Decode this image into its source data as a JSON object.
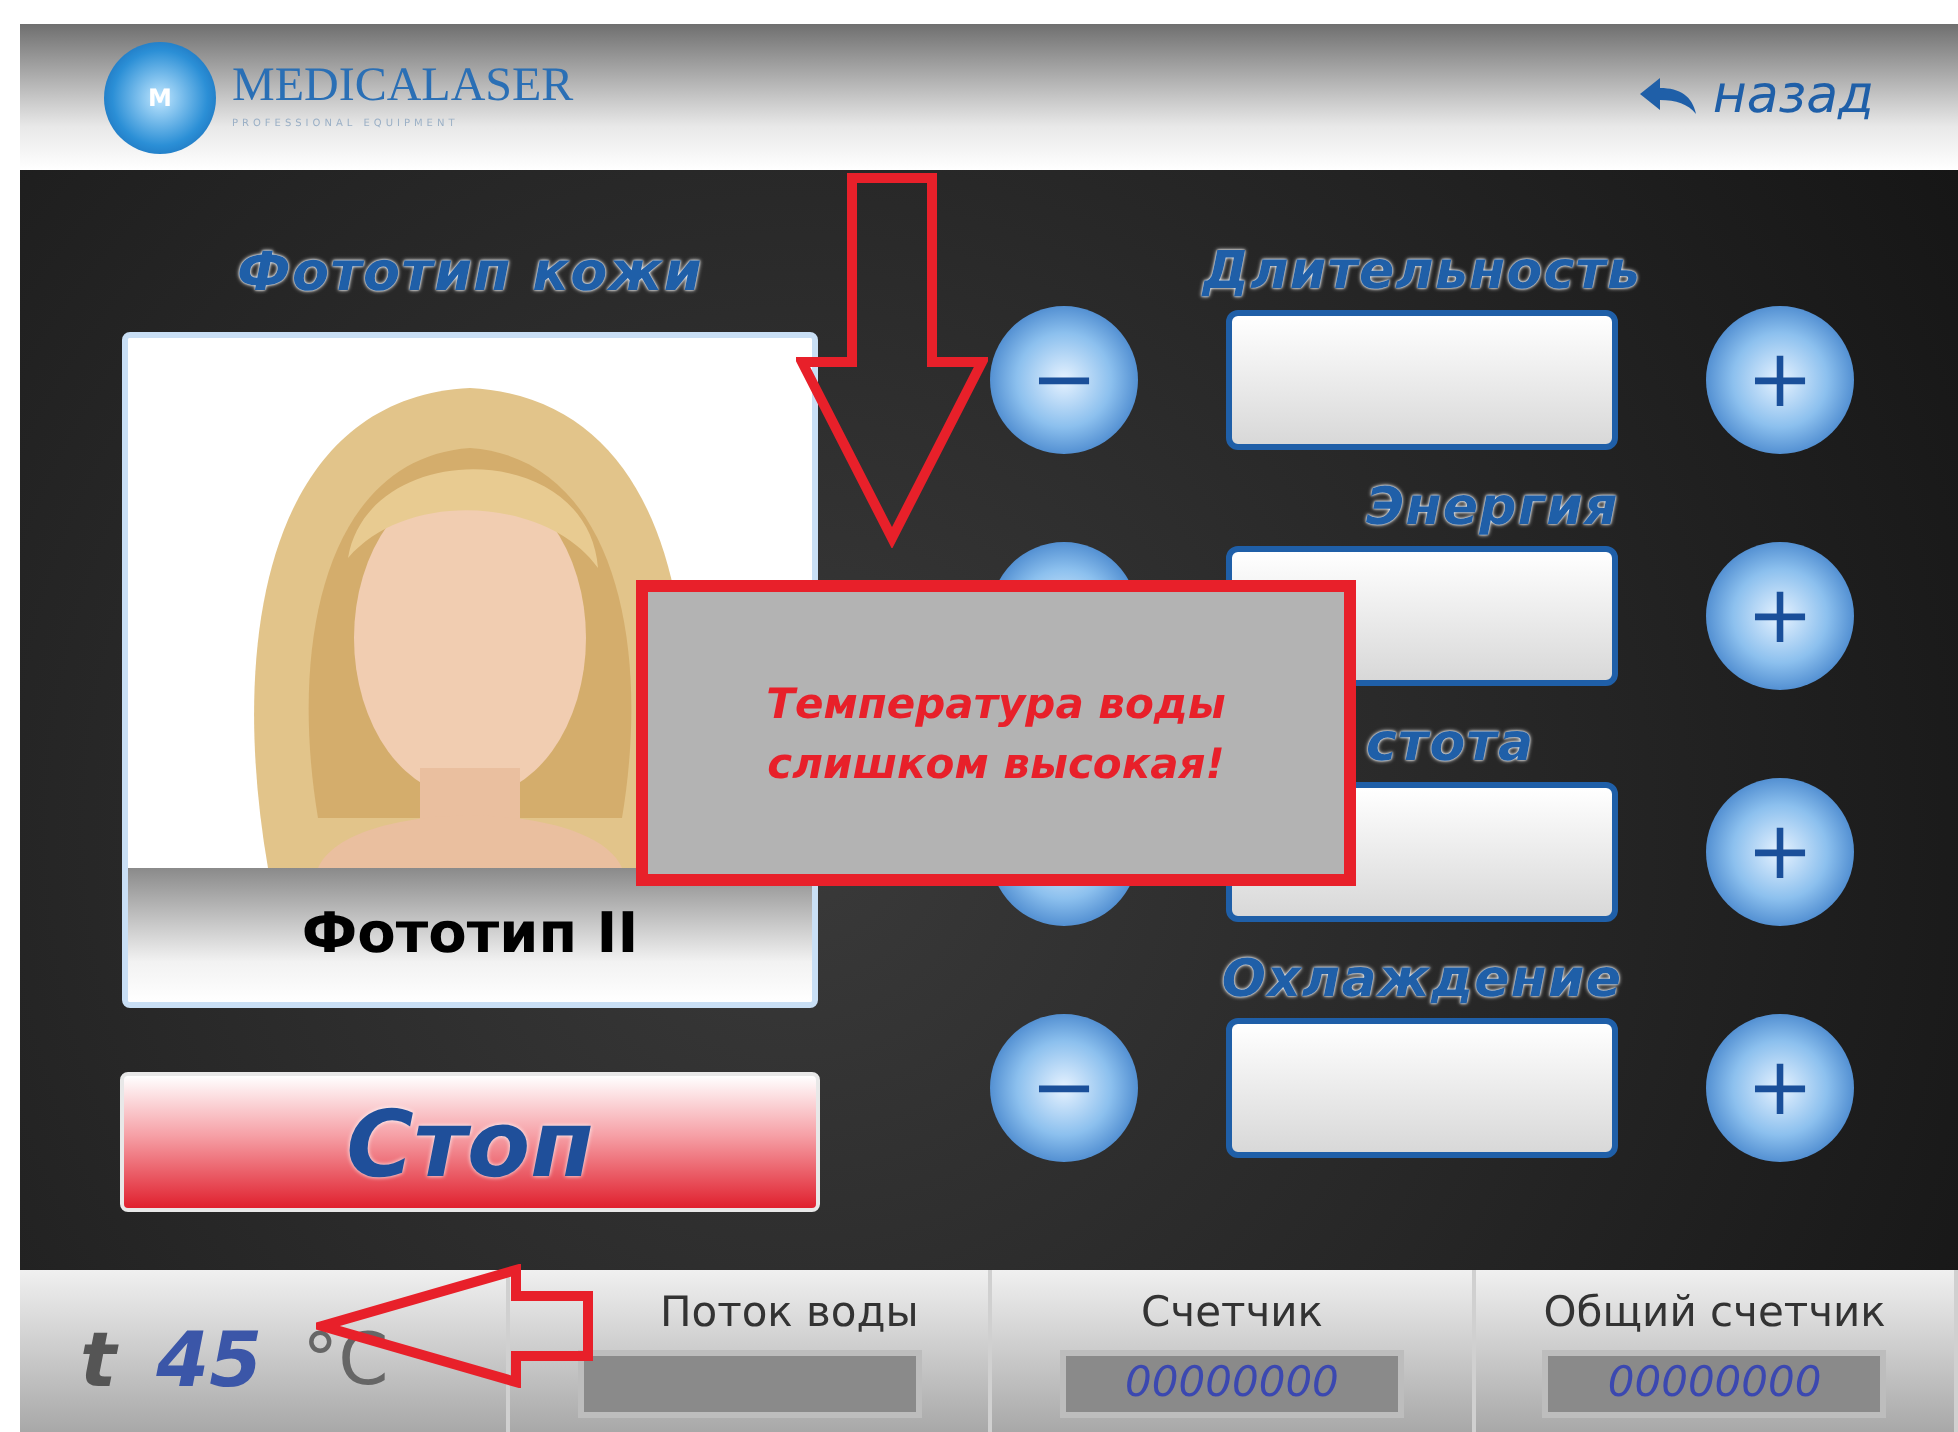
{
  "header": {
    "logo_text": "MEDICALASER",
    "logo_tagline": "PROFESSIONAL EQUIPMENT",
    "logo_mark": "M",
    "back_label": "назад"
  },
  "skin": {
    "title": "Фототип кожи",
    "caption": "Фототип II"
  },
  "stop_button": "Стоп",
  "parameters": [
    {
      "label": "Длительность",
      "minus": "−",
      "plus": "+"
    },
    {
      "label": "Энергия",
      "plus": "+"
    },
    {
      "label": "стота",
      "plus": "+"
    },
    {
      "label": "Охлаждение",
      "minus": "−",
      "plus": "+"
    }
  ],
  "alert": {
    "lines": [
      "Температура воды",
      "слишком высокая!"
    ]
  },
  "status_bar": {
    "temp_symbol": "t",
    "temp_value": "45",
    "temp_unit": "°C",
    "counters": [
      {
        "label": "Поток воды"
      },
      {
        "label": "Счетчик",
        "value": "00000000"
      },
      {
        "label": "Общий счетчик",
        "value": "00000000"
      }
    ]
  }
}
